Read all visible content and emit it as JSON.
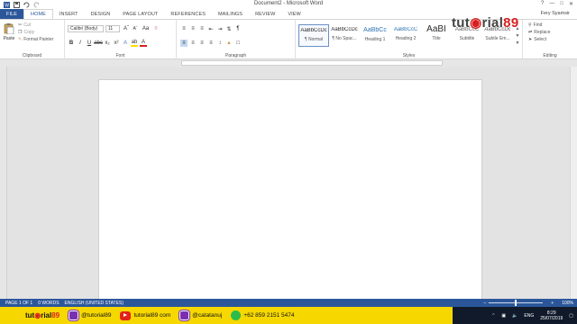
{
  "window": {
    "title": "Document2 - Microsoft Word",
    "user": "Fery Syamsir",
    "help": "?",
    "controls": [
      "—",
      "□",
      "✕"
    ]
  },
  "tabs": [
    {
      "label": "FILE"
    },
    {
      "label": "HOME"
    },
    {
      "label": "INSERT"
    },
    {
      "label": "DESIGN"
    },
    {
      "label": "PAGE LAYOUT"
    },
    {
      "label": "REFERENCES"
    },
    {
      "label": "MAILINGS"
    },
    {
      "label": "REVIEW"
    },
    {
      "label": "VIEW"
    }
  ],
  "ribbon": {
    "clipboard": {
      "label": "Clipboard",
      "paste": "Paste",
      "cut": "Cut",
      "copy": "Copy",
      "format_painter": "Format Painter"
    },
    "font": {
      "label": "Font",
      "font_name": "Calibri (Body)",
      "font_size": "11",
      "bold": "B",
      "italic": "I",
      "underline": "U"
    },
    "paragraph": {
      "label": "Paragraph"
    },
    "styles": {
      "label": "Styles",
      "items": [
        {
          "preview": "AaBbCcDc",
          "name": "¶ Normal"
        },
        {
          "preview": "AaBbCcDc",
          "name": "¶ No Spac..."
        },
        {
          "preview": "AaBbCc",
          "name": "Heading 1"
        },
        {
          "preview": "AaBbCcC",
          "name": "Heading 2"
        },
        {
          "preview": "AaBI",
          "name": "Title"
        },
        {
          "preview": "AaBbCcC",
          "name": "Subtitle"
        },
        {
          "preview": "AaBbCcDc",
          "name": "Subtle Em..."
        }
      ]
    },
    "editing": {
      "label": "Editing",
      "find": "Find",
      "replace": "Replace",
      "select": "Select"
    }
  },
  "watermark": {
    "prefix": "tut",
    "mid": "rial",
    "suffix": "89"
  },
  "status": {
    "page": "PAGE 1 OF 1",
    "words": "0 WORDS",
    "language": "ENGLISH (UNITED STATES)",
    "zoom": "100%",
    "zoom_level": 0.5
  },
  "promo": {
    "logo_prefix": "tut",
    "logo_mid": "rial",
    "logo_suffix": "89",
    "instagram_1": "@tutorial89",
    "youtube": "tutorial89 com",
    "instagram_2": "@catatanuj",
    "whatsapp": "+62 859 2151 5474"
  },
  "tray": {
    "language": "ENG",
    "time": "8:29",
    "date": "25/07/2019"
  },
  "colors": {
    "word_blue": "#2b579a",
    "promo_yellow": "#f6d800",
    "taskbar": "#101a2a"
  }
}
